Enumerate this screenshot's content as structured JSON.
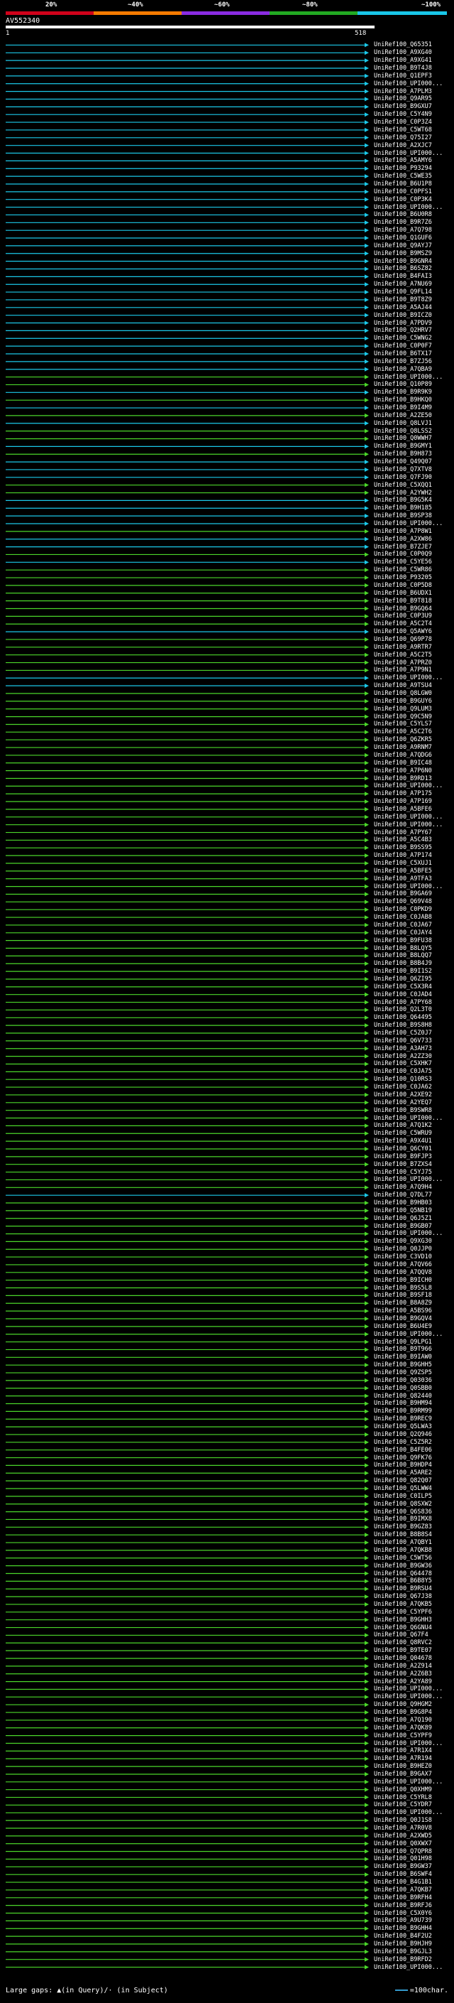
{
  "scale": {
    "ticks": [
      "20%",
      "~40%",
      "~60%",
      "~80%",
      "~100%"
    ],
    "colors": [
      "#d0021b",
      "#f57a00",
      "#8a2be2",
      "#22aa22",
      "#19c6e8"
    ]
  },
  "query": {
    "id": "AV552340",
    "start": "1",
    "end": "518"
  },
  "colors": {
    "blue": "#1cc8e8",
    "green": "#4bd62a",
    "dark_green": "#248a18",
    "gap_light": "#9bd98a"
  },
  "hits": [
    {
      "label": "UniRef100_Q65351",
      "color": "blue"
    },
    {
      "label": "UniRef100_A9XG40",
      "color": "blue"
    },
    {
      "label": "UniRef100_A9XG41",
      "color": "blue"
    },
    {
      "label": "UniRef100_B9T4J8",
      "color": "blue"
    },
    {
      "label": "UniRef100_Q1EPF3",
      "color": "blue"
    },
    {
      "label": "UniRef100_UPI000...",
      "color": "blue"
    },
    {
      "label": "UniRef100_A7PLM3",
      "color": "blue"
    },
    {
      "label": "UniRef100_Q9AR95",
      "color": "blue"
    },
    {
      "label": "UniRef100_B9GXU7",
      "color": "blue"
    },
    {
      "label": "UniRef100_C5Y4N9",
      "color": "blue"
    },
    {
      "label": "UniRef100_C0P3Z4",
      "color": "blue"
    },
    {
      "label": "UniRef100_C5WT68",
      "color": "blue"
    },
    {
      "label": "UniRef100_Q75I27",
      "color": "blue"
    },
    {
      "label": "UniRef100_A2XJC7",
      "color": "blue"
    },
    {
      "label": "UniRef100_UPI000...",
      "color": "blue"
    },
    {
      "label": "UniRef100_A5AMY6",
      "color": "blue"
    },
    {
      "label": "UniRef100_P93294",
      "color": "blue"
    },
    {
      "label": "UniRef100_C5WE35",
      "color": "blue"
    },
    {
      "label": "UniRef100_B6U1P8",
      "color": "blue"
    },
    {
      "label": "UniRef100_C0PFS1",
      "color": "blue"
    },
    {
      "label": "UniRef100_C0P3K4",
      "color": "blue"
    },
    {
      "label": "UniRef100_UPI000...",
      "color": "blue"
    },
    {
      "label": "UniRef100_B6U0R8",
      "color": "blue"
    },
    {
      "label": "UniRef100_B9R7Z6",
      "color": "blue"
    },
    {
      "label": "UniRef100_A7Q798",
      "color": "blue"
    },
    {
      "label": "UniRef100_Q1GUF6",
      "color": "blue"
    },
    {
      "label": "UniRef100_Q9AYJ7",
      "color": "blue"
    },
    {
      "label": "UniRef100_B9MSZ9",
      "color": "blue"
    },
    {
      "label": "UniRef100_B9GNR4",
      "color": "blue"
    },
    {
      "label": "UniRef100_B6SZ82",
      "color": "blue"
    },
    {
      "label": "UniRef100_B4FAI3",
      "color": "blue"
    },
    {
      "label": "UniRef100_A7NU69",
      "color": "blue"
    },
    {
      "label": "UniRef100_Q9FL14",
      "color": "blue"
    },
    {
      "label": "UniRef100_B9T8Z9",
      "color": "blue"
    },
    {
      "label": "UniRef100_A5AJ44",
      "color": "blue"
    },
    {
      "label": "UniRef100_B9ICZ0",
      "color": "blue"
    },
    {
      "label": "UniRef100_A7PDV9",
      "color": "blue"
    },
    {
      "label": "UniRef100_Q2HRV7",
      "color": "blue"
    },
    {
      "label": "UniRef100_C5WNG2",
      "color": "blue"
    },
    {
      "label": "UniRef100_C0P0F7",
      "color": "blue"
    },
    {
      "label": "UniRef100_B6TX17",
      "color": "blue"
    },
    {
      "label": "UniRef100_B7ZJ56",
      "color": "blue"
    },
    {
      "label": "UniRef100_A7QBA9",
      "color": "blue"
    },
    {
      "label": "UniRef100_UPI000...",
      "color": "green"
    },
    {
      "label": "UniRef100_Q10P89",
      "color": "green"
    },
    {
      "label": "UniRef100_B9R9K9",
      "color": "blue"
    },
    {
      "label": "UniRef100_B9HKQ0",
      "color": "green"
    },
    {
      "label": "UniRef100_B9I4M9",
      "color": "blue"
    },
    {
      "label": "UniRef100_A2ZE50",
      "color": "green"
    },
    {
      "label": "UniRef100_Q8LVJ1",
      "color": "blue"
    },
    {
      "label": "UniRef100_Q8LSS2",
      "color": "green"
    },
    {
      "label": "UniRef100_Q0WWH7",
      "color": "green"
    },
    {
      "label": "UniRef100_B9GMY1",
      "color": "blue"
    },
    {
      "label": "UniRef100_B9H873",
      "color": "green"
    },
    {
      "label": "UniRef100_Q49Q07",
      "color": "blue"
    },
    {
      "label": "UniRef100_Q7XTV8",
      "color": "blue"
    },
    {
      "label": "UniRef100_Q7FJ90",
      "color": "blue"
    },
    {
      "label": "UniRef100_C5XQQ1",
      "color": "green"
    },
    {
      "label": "UniRef100_A2YWH2",
      "color": "green"
    },
    {
      "label": "UniRef100_B9G5K4",
      "color": "blue"
    },
    {
      "label": "UniRef100_B9H185",
      "color": "blue"
    },
    {
      "label": "UniRef100_B9SP38",
      "color": "blue"
    },
    {
      "label": "UniRef100_UPI000...",
      "color": "blue"
    },
    {
      "label": "UniRef100_A7P8W1",
      "color": "green"
    },
    {
      "label": "UniRef100_A2XW86",
      "color": "blue"
    },
    {
      "label": "UniRef100_B7ZJE7",
      "color": "blue"
    },
    {
      "label": "UniRef100_C0P0Q9",
      "color": "green"
    },
    {
      "label": "UniRef100_C5YE56",
      "color": "blue"
    },
    {
      "label": "UniRef100_C5WR86",
      "color": "green"
    },
    {
      "label": "UniRef100_P93205",
      "color": "green"
    },
    {
      "label": "UniRef100_C0P5D8",
      "color": "green"
    },
    {
      "label": "UniRef100_B6UDX1",
      "color": "green"
    },
    {
      "label": "UniRef100_B9T818",
      "color": "green"
    },
    {
      "label": "UniRef100_B9GQ64",
      "color": "green"
    },
    {
      "label": "UniRef100_C0P3U9",
      "color": "green"
    },
    {
      "label": "UniRef100_A5C2T4",
      "color": "green"
    },
    {
      "label": "UniRef100_Q5AWY6",
      "color": "blue"
    },
    {
      "label": "UniRef100_Q69P78",
      "color": "green"
    },
    {
      "label": "UniRef100_A9RTR7",
      "color": "green"
    },
    {
      "label": "UniRef100_A5C2T5",
      "color": "green"
    },
    {
      "label": "UniRef100_A7PRZ0",
      "color": "green"
    },
    {
      "label": "UniRef100_A7P9N1",
      "color": "green"
    },
    {
      "label": "UniRef100_UPI000...",
      "color": "blue"
    },
    {
      "label": "UniRef100_A9TSU4",
      "color": "blue"
    },
    {
      "label": "UniRef100_Q8LGW0",
      "color": "green"
    },
    {
      "label": "UniRef100_B9GUY6",
      "color": "green"
    },
    {
      "label": "UniRef100_Q9LUM3",
      "color": "green"
    },
    {
      "label": "UniRef100_Q9C5N9",
      "color": "green"
    },
    {
      "label": "UniRef100_C5YLS7",
      "color": "green"
    },
    {
      "label": "UniRef100_A5C2T6",
      "color": "green"
    },
    {
      "label": "UniRef100_Q6ZKR5",
      "color": "green"
    },
    {
      "label": "UniRef100_A9RNM7",
      "color": "green"
    },
    {
      "label": "UniRef100_A7QDG6",
      "color": "green"
    },
    {
      "label": "UniRef100_B9IC48",
      "color": "green"
    },
    {
      "label": "UniRef100_A7P6N0",
      "color": "green"
    },
    {
      "label": "UniRef100_B9RD13",
      "color": "green"
    },
    {
      "label": "UniRef100_UPI000...",
      "color": "green"
    },
    {
      "label": "UniRef100_A7P175",
      "color": "green"
    },
    {
      "label": "UniRef100_A7P169",
      "color": "green"
    },
    {
      "label": "UniRef100_A5BFE6",
      "color": "green"
    },
    {
      "label": "UniRef100_UPI000...",
      "color": "green"
    },
    {
      "label": "UniRef100_UPI000...",
      "color": "green"
    },
    {
      "label": "UniRef100_A7PY67",
      "color": "green"
    },
    {
      "label": "UniRef100_A5C4B3",
      "color": "green"
    },
    {
      "label": "UniRef100_B9SS95",
      "color": "green"
    },
    {
      "label": "UniRef100_A7P174",
      "color": "green"
    },
    {
      "label": "UniRef100_C5XUJ1",
      "color": "green"
    },
    {
      "label": "UniRef100_A5BFE5",
      "color": "green"
    },
    {
      "label": "UniRef100_A9TFA3",
      "color": "green"
    },
    {
      "label": "UniRef100_UPI000...",
      "color": "green"
    },
    {
      "label": "UniRef100_B9GA69",
      "color": "green"
    },
    {
      "label": "UniRef100_Q69V48",
      "color": "green"
    },
    {
      "label": "UniRef100_C0PKD9",
      "color": "green"
    },
    {
      "label": "UniRef100_C0JAB8",
      "color": "green"
    },
    {
      "label": "UniRef100_C0JA67",
      "color": "green"
    },
    {
      "label": "UniRef100_C0JAY4",
      "color": "green"
    },
    {
      "label": "UniRef100_B9FU38",
      "color": "green"
    },
    {
      "label": "UniRef100_B8LQY5",
      "color": "green"
    },
    {
      "label": "UniRef100_B8LQQ7",
      "color": "green"
    },
    {
      "label": "UniRef100_B8B4J9",
      "color": "green"
    },
    {
      "label": "UniRef100_B9I1S2",
      "color": "green"
    },
    {
      "label": "UniRef100_Q6ZI95",
      "color": "green"
    },
    {
      "label": "UniRef100_C5X3R4",
      "color": "green"
    },
    {
      "label": "UniRef100_C0JAD4",
      "color": "green"
    },
    {
      "label": "UniRef100_A7PY68",
      "color": "green"
    },
    {
      "label": "UniRef100_Q2L3T0",
      "color": "green"
    },
    {
      "label": "UniRef100_Q64495",
      "color": "green"
    },
    {
      "label": "UniRef100_B9S8H8",
      "color": "green"
    },
    {
      "label": "UniRef100_C5Z0J7",
      "color": "green"
    },
    {
      "label": "UniRef100_Q6V733",
      "color": "green"
    },
    {
      "label": "UniRef100_A3AH73",
      "color": "green"
    },
    {
      "label": "UniRef100_A2ZZ30",
      "color": "green"
    },
    {
      "label": "UniRef100_C5XHK7",
      "color": "green"
    },
    {
      "label": "UniRef100_C0JA75",
      "color": "green"
    },
    {
      "label": "UniRef100_Q10RS3",
      "color": "green"
    },
    {
      "label": "UniRef100_C0JA62",
      "color": "green"
    },
    {
      "label": "UniRef100_A2XE92",
      "color": "green"
    },
    {
      "label": "UniRef100_A2YEQ7",
      "color": "green"
    },
    {
      "label": "UniRef100_B9SWR8",
      "color": "green"
    },
    {
      "label": "UniRef100_UPI000...",
      "color": "green"
    },
    {
      "label": "UniRef100_A7Q1K2",
      "color": "green"
    },
    {
      "label": "UniRef100_C5WRU9",
      "color": "green"
    },
    {
      "label": "UniRef100_A9X4U1",
      "color": "green"
    },
    {
      "label": "UniRef100_Q6CY01",
      "color": "green"
    },
    {
      "label": "UniRef100_B9FJP3",
      "color": "green"
    },
    {
      "label": "UniRef100_B7ZXS4",
      "color": "green"
    },
    {
      "label": "UniRef100_C5YJ75",
      "color": "green"
    },
    {
      "label": "UniRef100_UPI000...",
      "color": "green"
    },
    {
      "label": "UniRef100_A7Q9H4",
      "color": "green"
    },
    {
      "label": "UniRef100_Q7DL77",
      "color": "blue"
    },
    {
      "label": "UniRef100_B9HB03",
      "color": "green"
    },
    {
      "label": "UniRef100_Q5NB19",
      "color": "green"
    },
    {
      "label": "UniRef100_Q6J5Z1",
      "color": "green"
    },
    {
      "label": "UniRef100_B9GB07",
      "color": "green"
    },
    {
      "label": "UniRef100_UPI000...",
      "color": "green"
    },
    {
      "label": "UniRef100_Q9XG30",
      "color": "green"
    },
    {
      "label": "UniRef100_Q0JJP0",
      "color": "green"
    },
    {
      "label": "UniRef100_C3VD10",
      "color": "green"
    },
    {
      "label": "UniRef100_A7QV66",
      "color": "green"
    },
    {
      "label": "UniRef100_A7QQV8",
      "color": "green"
    },
    {
      "label": "UniRef100_B9ICH0",
      "color": "green"
    },
    {
      "label": "UniRef100_B9S5L8",
      "color": "green"
    },
    {
      "label": "UniRef100_B9SF18",
      "color": "green"
    },
    {
      "label": "UniRef100_B8A8Z9",
      "color": "green"
    },
    {
      "label": "UniRef100_A5BS96",
      "color": "green"
    },
    {
      "label": "UniRef100_B9GQV4",
      "color": "green"
    },
    {
      "label": "UniRef100_B6U4E9",
      "color": "green"
    },
    {
      "label": "UniRef100_UPI000...",
      "color": "green"
    },
    {
      "label": "UniRef100_Q9LPG1",
      "color": "green"
    },
    {
      "label": "UniRef100_B9T966",
      "color": "green"
    },
    {
      "label": "UniRef100_B9IAW0",
      "color": "green"
    },
    {
      "label": "UniRef100_B9GHH5",
      "color": "green"
    },
    {
      "label": "UniRef100_Q9ZSP5",
      "color": "green"
    },
    {
      "label": "UniRef100_Q03036",
      "color": "green"
    },
    {
      "label": "UniRef100_Q0SBB0",
      "color": "green"
    },
    {
      "label": "UniRef100_Q82440",
      "color": "green"
    },
    {
      "label": "UniRef100_B9HM94",
      "color": "green"
    },
    {
      "label": "UniRef100_B9RM99",
      "color": "green"
    },
    {
      "label": "UniRef100_B9REC9",
      "color": "green"
    },
    {
      "label": "UniRef100_Q5LWA3",
      "color": "green"
    },
    {
      "label": "UniRef100_Q2Q946",
      "color": "green"
    },
    {
      "label": "UniRef100_C5Z5R2",
      "color": "green"
    },
    {
      "label": "UniRef100_B4FE06",
      "color": "green"
    },
    {
      "label": "UniRef100_Q9FK76",
      "color": "green"
    },
    {
      "label": "UniRef100_B9HDP4",
      "color": "green"
    },
    {
      "label": "UniRef100_A5ARE2",
      "color": "green"
    },
    {
      "label": "UniRef100_Q82Q07",
      "color": "green"
    },
    {
      "label": "UniRef100_Q5LWW4",
      "color": "green"
    },
    {
      "label": "UniRef100_C0ILP5",
      "color": "green"
    },
    {
      "label": "UniRef100_Q8SXW2",
      "color": "green"
    },
    {
      "label": "UniRef100_Q6S836",
      "color": "green"
    },
    {
      "label": "UniRef100_B9IMX8",
      "color": "green"
    },
    {
      "label": "UniRef100_B9GZ83",
      "color": "green"
    },
    {
      "label": "UniRef100_B8B8S4",
      "color": "green"
    },
    {
      "label": "UniRef100_A7QBY1",
      "color": "green"
    },
    {
      "label": "UniRef100_A7QKB8",
      "color": "green"
    },
    {
      "label": "UniRef100_C5WT56",
      "color": "green"
    },
    {
      "label": "UniRef100_B9GW36",
      "color": "green"
    },
    {
      "label": "UniRef100_Q64478",
      "color": "green"
    },
    {
      "label": "UniRef100_B6B8Y5",
      "color": "green"
    },
    {
      "label": "UniRef100_B9RSU4",
      "color": "green"
    },
    {
      "label": "UniRef100_Q67J38",
      "color": "green"
    },
    {
      "label": "UniRef100_A7QKB5",
      "color": "green"
    },
    {
      "label": "UniRef100_C5YPF6",
      "color": "green"
    },
    {
      "label": "UniRef100_B9GHH3",
      "color": "green"
    },
    {
      "label": "UniRef100_Q6GNU4",
      "color": "green"
    },
    {
      "label": "UniRef100_Q67F4",
      "color": "green"
    },
    {
      "label": "UniRef100_Q8RVC2",
      "color": "green"
    },
    {
      "label": "UniRef100_B9TE07",
      "color": "green"
    },
    {
      "label": "UniRef100_Q04678",
      "color": "green"
    },
    {
      "label": "UniRef100_A2Z914",
      "color": "green"
    },
    {
      "label": "UniRef100_A2Z6B3",
      "color": "green"
    },
    {
      "label": "UniRef100_A2YA89",
      "color": "green"
    },
    {
      "label": "UniRef100_UPI000...",
      "color": "green"
    },
    {
      "label": "UniRef100_UPI000...",
      "color": "green"
    },
    {
      "label": "UniRef100_Q9HGM2",
      "color": "green"
    },
    {
      "label": "UniRef100_B9G8P4",
      "color": "green"
    },
    {
      "label": "UniRef100_A7Q190",
      "color": "green"
    },
    {
      "label": "UniRef100_A7QK89",
      "color": "green"
    },
    {
      "label": "UniRef100_C5YPF9",
      "color": "green"
    },
    {
      "label": "UniRef100_UPI000...",
      "color": "green"
    },
    {
      "label": "UniRef100_A7R1X4",
      "color": "green"
    },
    {
      "label": "UniRef100_A7R194",
      "color": "green"
    },
    {
      "label": "UniRef100_B9HEZ0",
      "color": "green"
    },
    {
      "label": "UniRef100_B9GAX7",
      "color": "green"
    },
    {
      "label": "UniRef100_UPI000...",
      "color": "green"
    },
    {
      "label": "UniRef100_Q0XHM9",
      "color": "green"
    },
    {
      "label": "UniRef100_C5YRL8",
      "color": "green"
    },
    {
      "label": "UniRef100_C5YDR7",
      "color": "green"
    },
    {
      "label": "UniRef100_UPI000...",
      "color": "green"
    },
    {
      "label": "UniRef100_Q0J1S8",
      "color": "green"
    },
    {
      "label": "UniRef100_A7R0V8",
      "color": "green"
    },
    {
      "label": "UniRef100_A2XWD5",
      "color": "green"
    },
    {
      "label": "UniRef100_Q0XWX7",
      "color": "green"
    },
    {
      "label": "UniRef100_Q7QPR8",
      "color": "green"
    },
    {
      "label": "UniRef100_Q01H98",
      "color": "green"
    },
    {
      "label": "UniRef100_B9GW37",
      "color": "green"
    },
    {
      "label": "UniRef100_B6SWF4",
      "color": "green"
    },
    {
      "label": "UniRef100_B4G1B1",
      "color": "green"
    },
    {
      "label": "UniRef100_A7QKB7",
      "color": "green"
    },
    {
      "label": "UniRef100_B9RFH4",
      "color": "green"
    },
    {
      "label": "UniRef100_B9RFJ6",
      "color": "green"
    },
    {
      "label": "UniRef100_C5X0Y6",
      "color": "green"
    },
    {
      "label": "UniRef100_A9U739",
      "color": "green"
    },
    {
      "label": "UniRef100_B9GHH4",
      "color": "green"
    },
    {
      "label": "UniRef100_B4F2U2",
      "color": "green"
    },
    {
      "label": "UniRef100_B9HJH9",
      "color": "green"
    },
    {
      "label": "UniRef100_B9GJL3",
      "color": "green"
    },
    {
      "label": "UniRef100_B9RFD2",
      "color": "green"
    },
    {
      "label": "UniRef100_UPI000...",
      "color": "green"
    }
  ],
  "footer": {
    "gaps_text": "Large gaps: ▲(in Query)/· (in Subject)",
    "legend_text": "=100char."
  }
}
